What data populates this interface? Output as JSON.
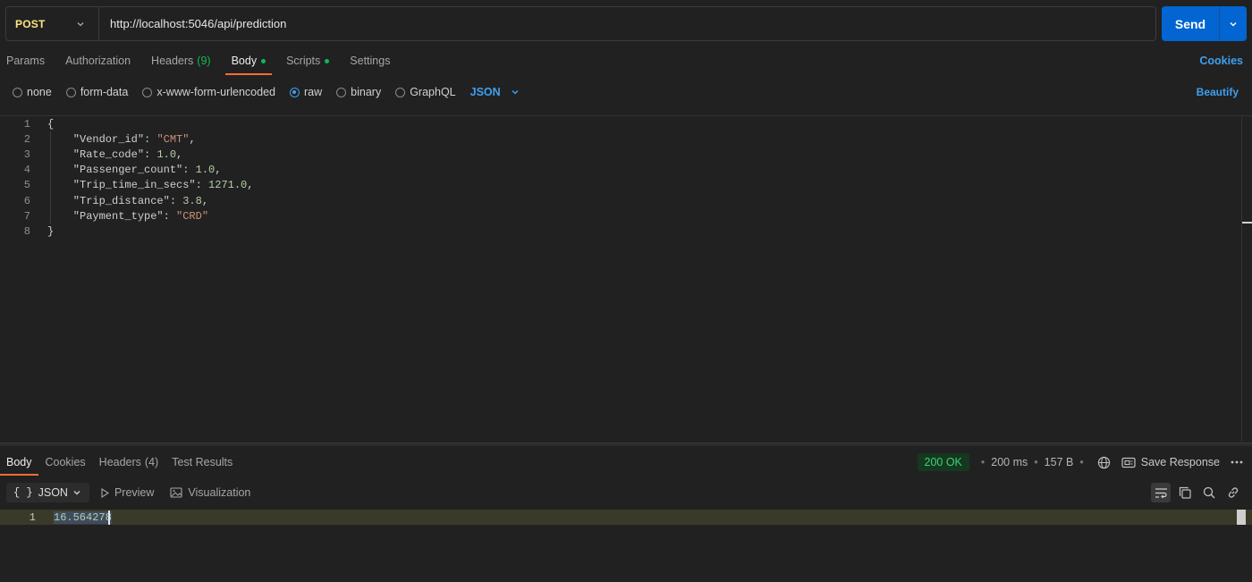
{
  "request": {
    "method": "POST",
    "url": "http://localhost:5046/api/prediction",
    "send_label": "Send"
  },
  "tabs": [
    {
      "label": "Params"
    },
    {
      "label": "Authorization"
    },
    {
      "label": "Headers",
      "count": "(9)"
    },
    {
      "label": "Body"
    },
    {
      "label": "Scripts"
    },
    {
      "label": "Settings"
    }
  ],
  "cookies_label": "Cookies",
  "body_types": [
    "none",
    "form-data",
    "x-www-form-urlencoded",
    "raw",
    "binary",
    "GraphQL"
  ],
  "selected_body_type": "raw",
  "language": "JSON",
  "beautify_label": "Beautify",
  "editor": {
    "line_numbers": [
      "1",
      "2",
      "3",
      "4",
      "5",
      "6",
      "7",
      "8"
    ],
    "lines": [
      [
        {
          "t": "punc",
          "v": "{"
        }
      ],
      [
        {
          "t": "key",
          "v": "    \"Vendor_id\""
        },
        {
          "t": "punc",
          "v": ": "
        },
        {
          "t": "str",
          "v": "\"CMT\""
        },
        {
          "t": "punc",
          "v": ","
        }
      ],
      [
        {
          "t": "key",
          "v": "    \"Rate_code\""
        },
        {
          "t": "punc",
          "v": ": "
        },
        {
          "t": "num",
          "v": "1.0"
        },
        {
          "t": "punc",
          "v": ","
        }
      ],
      [
        {
          "t": "key",
          "v": "    \"Passenger_count\""
        },
        {
          "t": "punc",
          "v": ": "
        },
        {
          "t": "num",
          "v": "1.0"
        },
        {
          "t": "punc",
          "v": ","
        }
      ],
      [
        {
          "t": "key",
          "v": "    \"Trip_time_in_secs\""
        },
        {
          "t": "punc",
          "v": ": "
        },
        {
          "t": "num",
          "v": "1271.0"
        },
        {
          "t": "punc",
          "v": ","
        }
      ],
      [
        {
          "t": "key",
          "v": "    \"Trip_distance\""
        },
        {
          "t": "punc",
          "v": ": "
        },
        {
          "t": "num",
          "v": "3.8"
        },
        {
          "t": "punc",
          "v": ","
        }
      ],
      [
        {
          "t": "key",
          "v": "    \"Payment_type\""
        },
        {
          "t": "punc",
          "v": ": "
        },
        {
          "t": "str",
          "v": "\"CRD\""
        }
      ],
      [
        {
          "t": "punc",
          "v": "}"
        }
      ]
    ]
  },
  "response": {
    "tabs": {
      "body": "Body",
      "cookies": "Cookies",
      "headers": "Headers",
      "headers_count": "(4)",
      "test_results": "Test Results"
    },
    "status": "200 OK",
    "time": "200 ms",
    "size": "157 B",
    "save_label": "Save Response",
    "format": "JSON",
    "preview_label": "Preview",
    "visualization_label": "Visualization",
    "line_number": "1",
    "value": "16.564278"
  },
  "colors": {
    "accent_orange": "#ff6c37",
    "link_blue": "#3ea0f0",
    "send_blue": "#0265d2",
    "status_green": "#3fd17a"
  }
}
